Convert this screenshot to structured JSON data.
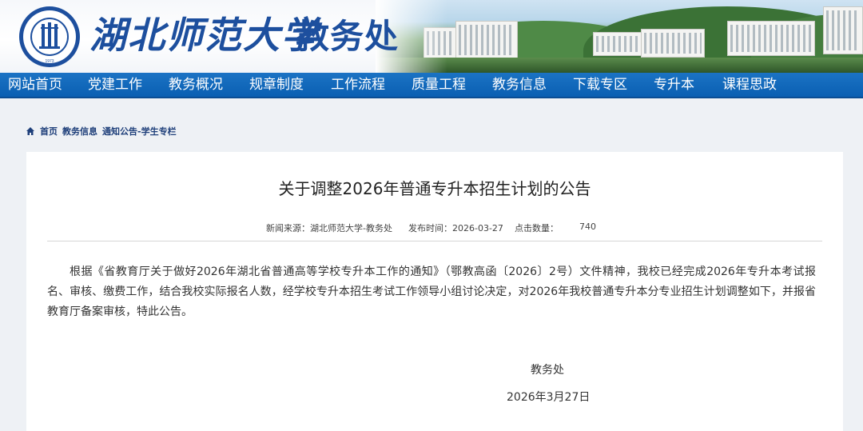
{
  "header": {
    "university_name": "湖北师范大学",
    "department": "教务处",
    "logo_text": "HUBEI NORMAL UNIVERSITY",
    "logo_year": "1973"
  },
  "nav": {
    "items": [
      {
        "label": "网站首页"
      },
      {
        "label": "党建工作"
      },
      {
        "label": "教务概况"
      },
      {
        "label": "规章制度"
      },
      {
        "label": "工作流程"
      },
      {
        "label": "质量工程"
      },
      {
        "label": "教务信息"
      },
      {
        "label": "下载专区"
      },
      {
        "label": "专升本"
      },
      {
        "label": "课程思政"
      }
    ]
  },
  "breadcrumb": {
    "home": "首页",
    "level1": "教务信息",
    "level2": "通知公告-学生专栏"
  },
  "article": {
    "title": "关于调整2026年普通专升本招生计划的公告",
    "source_label": "新闻来源：湖北师范大学-教务处",
    "date_label": "发布时间：2026-03-27",
    "views_label": "点击数量：",
    "views_value": "740",
    "body": "根据《省教育厅关于做好2026年湖北省普通高等学校专升本工作的通知》（鄂教高函〔2026〕2号）文件精神，我校已经完成2026年专升本考试报名、审核、缴费工作，结合我校实际报名人数，经学校专升本招生考试工作领导小组讨论决定，对2026年我校普通专升本分专业招生计划调整如下，并报省教育厅备案审核，特此公告。",
    "signature": "教务处",
    "sign_date": "2026年3月27日"
  },
  "colors": {
    "nav_bg": "#0a5fb2",
    "brand_blue": "#1d4f9e",
    "breadcrumb": "#1e3f7a"
  },
  "icons": {
    "home": "home-icon",
    "logo": "university-seal-logo"
  }
}
